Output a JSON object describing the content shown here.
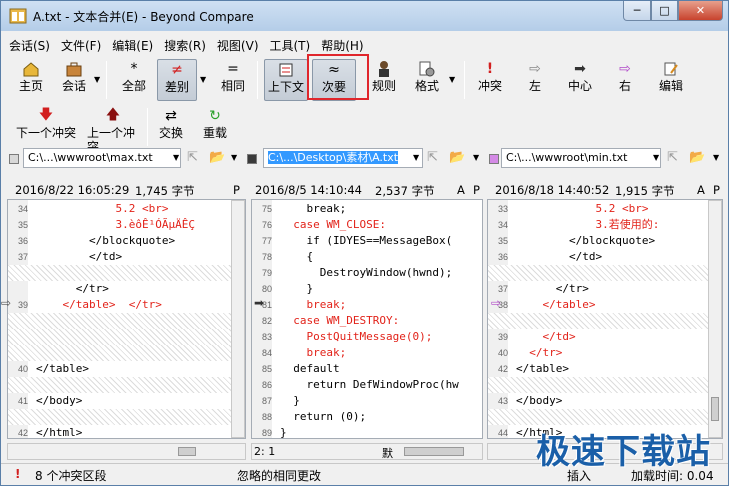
{
  "window": {
    "title": "A.txt - 文本合并(E) - Beyond Compare",
    "min": "─",
    "max": "□",
    "close": "✕"
  },
  "menu": [
    "会话(S)",
    "文件(F)",
    "编辑(E)",
    "搜索(R)",
    "视图(V)",
    "工具(T)",
    "帮助(H)"
  ],
  "toolbar": {
    "home": "主页",
    "sessions": "会话",
    "all": "全部",
    "diffs": "差别",
    "same": "相同",
    "context": "上下文",
    "minor": "次要",
    "rules": "规则",
    "format": "格式",
    "conflicts": "冲突",
    "left": "左",
    "center": "中心",
    "right": "右",
    "edit": "编辑"
  },
  "toolbar2": {
    "next_conflict": "下一个冲突",
    "prev_conflict": "上一个冲突",
    "swap": "交换",
    "reload": "重载"
  },
  "paths": {
    "left": "C:\\...\\wwwroot\\max.txt",
    "center": "C:\\...\\Desktop\\素材\\A.txt",
    "right": "C:\\...\\wwwroot\\min.txt"
  },
  "info": {
    "left_date": "2016/8/22 16:05:29",
    "left_size": "1,745 字节",
    "left_flag": "P",
    "center_date": "2016/8/5 14:10:44",
    "center_size": "2,537 字节",
    "center_flag1": "A",
    "center_flag2": "P",
    "right_date": "2016/8/18 14:40:52",
    "right_size": "1,915 字节",
    "right_flag1": "A",
    "right_flag2": "P"
  },
  "left_lines": [
    {
      "n": "34",
      "t": "            5.2 <br>",
      "red": true
    },
    {
      "n": "35",
      "t": "            3.èôÊ¹ÓÃµÄÊÇ",
      "red": true
    },
    {
      "n": "36",
      "t": "        </blockquote>",
      "red": false
    },
    {
      "n": "37",
      "t": "        </td>",
      "red": false
    },
    {
      "n": "",
      "t": "",
      "hatch": true
    },
    {
      "n": "",
      "t": "      </tr>",
      "red": false
    },
    {
      "n": "39",
      "t": "    </table>  </tr>",
      "red": true
    },
    {
      "n": "",
      "t": "",
      "hatch": true
    },
    {
      "n": "",
      "t": "",
      "hatch": true
    },
    {
      "n": "",
      "t": "",
      "hatch": true
    },
    {
      "n": "40",
      "t": "</table>",
      "red": false
    },
    {
      "n": "",
      "t": "",
      "hatch": true
    },
    {
      "n": "41",
      "t": "</body>",
      "red": false
    },
    {
      "n": "",
      "t": "",
      "hatch": true
    },
    {
      "n": "42",
      "t": "</html>",
      "red": false
    }
  ],
  "center_lines": [
    {
      "n": "75",
      "t": "    break;",
      "red": false
    },
    {
      "n": "76",
      "t": "  case WM_CLOSE:",
      "red": true
    },
    {
      "n": "77",
      "t": "    if (IDYES==MessageBox(",
      "red": false
    },
    {
      "n": "78",
      "t": "    {",
      "red": false
    },
    {
      "n": "79",
      "t": "      DestroyWindow(hwnd);",
      "red": false
    },
    {
      "n": "80",
      "t": "    }",
      "red": false
    },
    {
      "n": "81",
      "t": "    break;",
      "red": true
    },
    {
      "n": "82",
      "t": "  case WM_DESTROY:",
      "red": true
    },
    {
      "n": "83",
      "t": "    PostQuitMessage(0);",
      "red": true
    },
    {
      "n": "84",
      "t": "    break;",
      "red": true
    },
    {
      "n": "85",
      "t": "  default",
      "red": false
    },
    {
      "n": "86",
      "t": "    return DefWindowProc(hw",
      "red": false
    },
    {
      "n": "87",
      "t": "  }",
      "red": false
    },
    {
      "n": "88",
      "t": "  return (0);",
      "red": false
    },
    {
      "n": "89",
      "t": "}",
      "red": false
    }
  ],
  "right_lines": [
    {
      "n": "33",
      "t": "            5.2 <br>",
      "red": true
    },
    {
      "n": "34",
      "t": "            3.若使用的:",
      "red": true
    },
    {
      "n": "35",
      "t": "        </blockquote>",
      "red": false
    },
    {
      "n": "36",
      "t": "        </td>",
      "red": false
    },
    {
      "n": "",
      "t": "",
      "hatch": true
    },
    {
      "n": "37",
      "t": "      </tr>",
      "red": false
    },
    {
      "n": "38",
      "t": "    </table>",
      "red": true
    },
    {
      "n": "",
      "t": "",
      "hatch": true
    },
    {
      "n": "39",
      "t": "    </td>",
      "red": true
    },
    {
      "n": "40",
      "t": "  </tr>",
      "red": true
    },
    {
      "n": "42",
      "t": "</table>",
      "red": false
    },
    {
      "n": "",
      "t": "",
      "hatch": true
    },
    {
      "n": "43",
      "t": "</body>",
      "red": false
    },
    {
      "n": "",
      "t": "",
      "hatch": true
    },
    {
      "n": "44",
      "t": "</html>",
      "red": false
    }
  ],
  "center_status": {
    "pos": "2: 1",
    "mode": "默"
  },
  "status": {
    "conflicts": "8 个冲突区段",
    "ignored": "忽略的相同更改",
    "insert": "插入",
    "load_time": "加载时间: 0.04"
  },
  "watermark": "极速下载站"
}
